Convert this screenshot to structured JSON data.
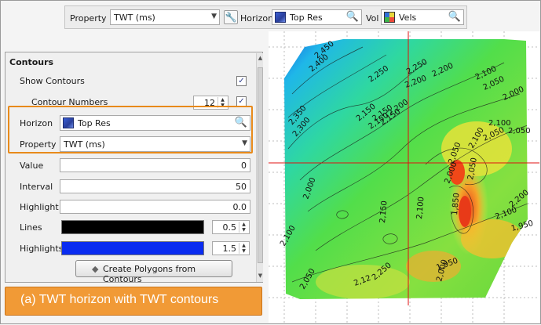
{
  "toolbar": {
    "property_label": "Property",
    "property_value": "TWT (ms)",
    "horizon_label": "Horizon",
    "horizon_value": "Top Res",
    "vol_label": "Vol",
    "vol_value": "Vels"
  },
  "contours": {
    "title": "Contours",
    "show_contours_label": "Show Contours",
    "contour_numbers_label": "Contour Numbers",
    "contour_numbers_value": "12",
    "horizon_label": "Horizon",
    "horizon_value": "Top Res",
    "property_label": "Property",
    "property_value": "TWT (ms)",
    "value_label": "Value",
    "value_value": "0",
    "interval_label": "Interval",
    "interval_value": "50",
    "highlight_label": "Highlight",
    "highlight_value": "0.0",
    "lines_label": "Lines",
    "lines_value": "0.5",
    "highlights_label": "Highlights",
    "highlights_value": "1.5",
    "create_button": "Create Polygons from Contours",
    "colors": {
      "lines": "#000000",
      "highlights": "#0a2cf0"
    }
  },
  "caption": "(a) TWT horizon with TWT contours",
  "map": {
    "contour_labels": [
      "2,450",
      "2,400",
      "2,350",
      "2,300",
      "2,250",
      "2,250",
      "2,200",
      "2,200",
      "2,150",
      "2,150",
      "2,100",
      "2,050",
      "2,000",
      "2,200",
      "2,150",
      "2,150",
      "2,100",
      "2,050",
      "2,050",
      "2,100",
      "2,050",
      "2,000",
      "1,850",
      "2,200",
      "2,100",
      "1,950",
      "2,050",
      "2,100",
      "1,950",
      "2,000",
      "2,050",
      "2,12",
      "2,250",
      "2,150",
      "2,100",
      "2,000"
    ]
  }
}
